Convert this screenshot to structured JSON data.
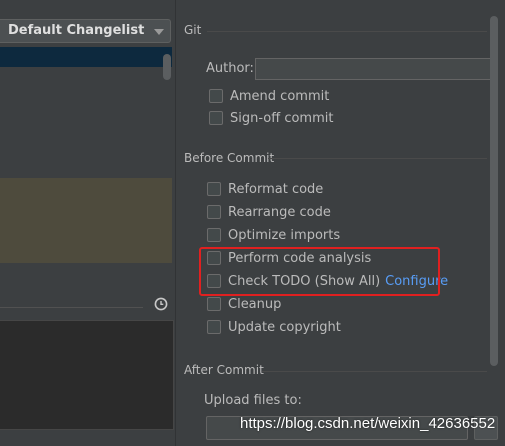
{
  "left_panel": {
    "changelist_selected": "Default Changelist"
  },
  "git": {
    "title": "Git",
    "author_label": "Author:",
    "author_value": "",
    "amend_commit": "Amend commit",
    "sign_off_commit": "Sign-off commit"
  },
  "before_commit": {
    "title": "Before Commit",
    "reformat_code": "Reformat code",
    "rearrange_code": "Rearrange code",
    "optimize_imports": "Optimize imports",
    "perform_code_analysis": "Perform code analysis",
    "check_todo": "Check TODO (Show All)",
    "configure_link": "Configure",
    "cleanup": "Cleanup",
    "update_copyright": "Update copyright"
  },
  "after_commit": {
    "title": "After Commit",
    "upload_files_label": "Upload files to:"
  },
  "watermark": "https://blog.csdn.net/weixin_42636552",
  "colors": {
    "background": "#3c3f41",
    "highlight_box": "#e02020",
    "link": "#589df6"
  }
}
